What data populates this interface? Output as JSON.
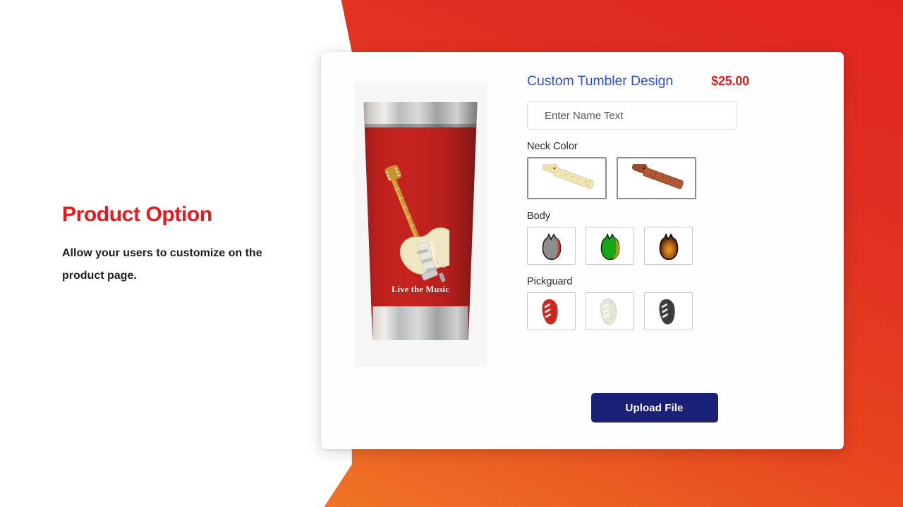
{
  "theme": {
    "accent_red": "#e12622",
    "accent_orange": "#ef7626",
    "title_blue": "#2b4ee0",
    "price_red": "#e21b18",
    "button_navy": "#1b2077"
  },
  "copy": {
    "title": "Product Option",
    "body": "Allow your users to customize on the product page."
  },
  "card": {
    "preview": {
      "name": "tumbler-preview",
      "caption": "Live the Music",
      "tumbler_color": "#c6231f",
      "graphic": "electric-guitar"
    },
    "header": {
      "title": "Custom Tumbler Design",
      "price": "$25.00"
    },
    "name_field": {
      "placeholder": "Enter Name Text",
      "value": ""
    },
    "options": [
      {
        "label": "Neck Color",
        "kind": "neck",
        "swatches": [
          {
            "name": "maple",
            "icon": "guitar-neck-maple-icon",
            "selected": true
          },
          {
            "name": "rosewood",
            "icon": "guitar-neck-rosewood-icon",
            "selected": false
          }
        ]
      },
      {
        "label": "Body",
        "kind": "body",
        "swatches": [
          {
            "name": "gray",
            "icon": "guitar-body-gray-icon",
            "selected": false
          },
          {
            "name": "green",
            "icon": "guitar-body-green-icon",
            "selected": false
          },
          {
            "name": "sunburst",
            "icon": "guitar-body-sunburst-icon",
            "selected": false
          }
        ]
      },
      {
        "label": "Pickguard",
        "kind": "pick",
        "swatches": [
          {
            "name": "red",
            "icon": "pickguard-red-icon",
            "selected": false
          },
          {
            "name": "white",
            "icon": "pickguard-white-icon",
            "selected": false
          },
          {
            "name": "black",
            "icon": "pickguard-black-icon",
            "selected": false
          }
        ]
      }
    ],
    "upload_label": "Upload File"
  }
}
